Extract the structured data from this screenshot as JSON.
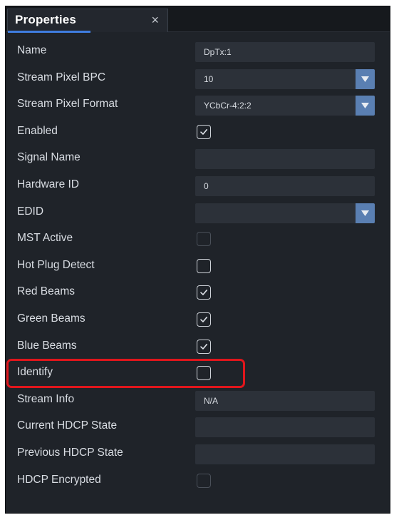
{
  "panel": {
    "tab_label": "Properties",
    "tab_close": "×"
  },
  "properties": [
    {
      "label": "Name",
      "kind": "text",
      "value": "DpTx:1"
    },
    {
      "label": "Stream Pixel BPC",
      "kind": "select",
      "value": "10"
    },
    {
      "label": "Stream Pixel Format",
      "kind": "select",
      "value": "YCbCr-4:2:2"
    },
    {
      "label": "Enabled",
      "kind": "checkbox",
      "checked": true,
      "disabled": false
    },
    {
      "label": "Signal Name",
      "kind": "text",
      "value": ""
    },
    {
      "label": "Hardware ID",
      "kind": "text",
      "value": "0"
    },
    {
      "label": "EDID",
      "kind": "select",
      "value": ""
    },
    {
      "label": "MST Active",
      "kind": "checkbox",
      "checked": false,
      "disabled": true
    },
    {
      "label": "Hot Plug Detect",
      "kind": "checkbox",
      "checked": false,
      "disabled": false
    },
    {
      "label": "Red Beams",
      "kind": "checkbox",
      "checked": true,
      "disabled": false
    },
    {
      "label": "Green Beams",
      "kind": "checkbox",
      "checked": true,
      "disabled": false
    },
    {
      "label": "Blue Beams",
      "kind": "checkbox",
      "checked": true,
      "disabled": false
    },
    {
      "label": "Identify",
      "kind": "checkbox",
      "checked": false,
      "disabled": false
    },
    {
      "label": "Stream Info",
      "kind": "text",
      "value": "N/A"
    },
    {
      "label": "Current HDCP State",
      "kind": "text",
      "value": ""
    },
    {
      "label": "Previous HDCP State",
      "kind": "text",
      "value": ""
    },
    {
      "label": "HDCP Encrypted",
      "kind": "checkbox",
      "checked": false,
      "disabled": true
    }
  ],
  "colors": {
    "panel_bg": "#1f2329",
    "field_bg": "#2c3139",
    "dropdown_button": "#5a7fb2",
    "tab_underline": "#3f7de0",
    "highlight_outline": "#e0161c"
  },
  "icons": {
    "dropdown": "chevron-down-icon",
    "check": "checkmark-icon",
    "close": "close-icon"
  }
}
